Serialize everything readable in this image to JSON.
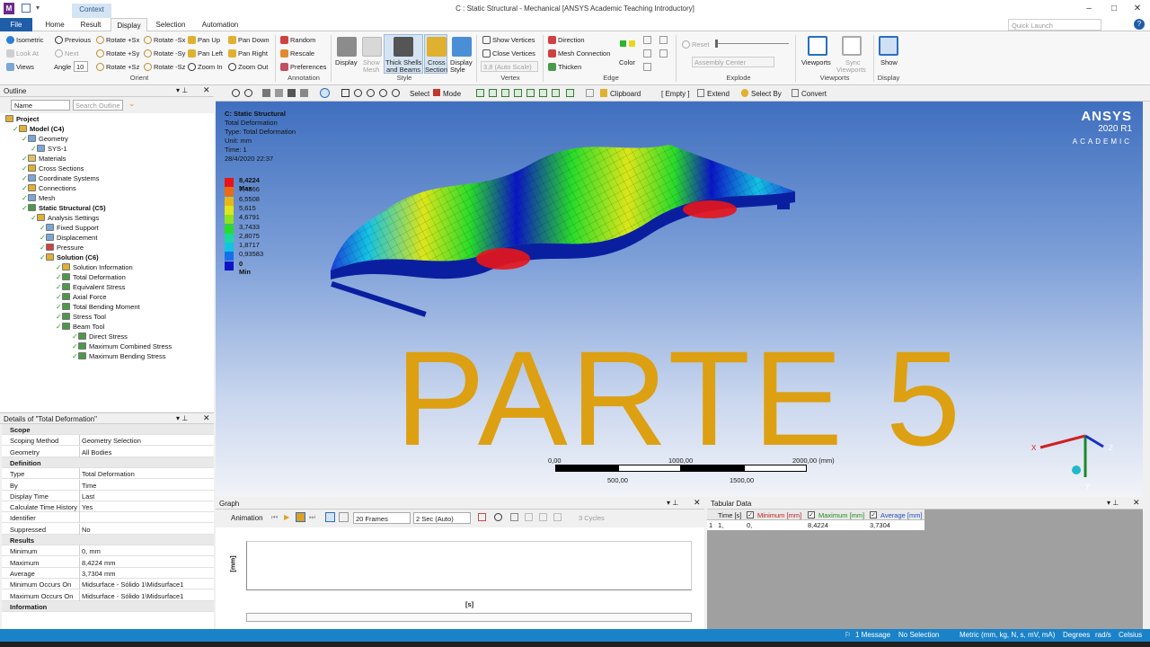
{
  "window": {
    "title": "C : Static Structural - Mechanical [ANSYS Academic Teaching Introductory]",
    "context_tab": "Context",
    "minimize": "–",
    "maximize": "□",
    "close": "✕"
  },
  "tabs": {
    "file": "File",
    "home": "Home",
    "result": "Result",
    "display": "Display",
    "selection": "Selection",
    "automation": "Automation"
  },
  "quick_launch": {
    "placeholder": "Quick Launch"
  },
  "ribbon": {
    "orient": {
      "isometric": "Isometric",
      "previous": "Previous",
      "look_at": "Look At",
      "next": "Next",
      "views": "Views",
      "angle_label": "Angle",
      "angle_value": "10",
      "rotate_px": "Rotate +Sx",
      "rotate_mx": "Rotate -Sx",
      "rotate_py": "Rotate +Sy",
      "rotate_my": "Rotate -Sy",
      "rotate_pz": "Rotate +Sz",
      "rotate_mz": "Rotate -Sz",
      "pan_up": "Pan Up",
      "pan_down": "Pan Down",
      "pan_left": "Pan Left",
      "pan_right": "Pan Right",
      "zoom_in": "Zoom In",
      "zoom_out": "Zoom Out",
      "group": "Orient"
    },
    "annotation": {
      "random": "Random",
      "rescale": "Rescale",
      "preferences": "Preferences",
      "group": "Annotation"
    },
    "style": {
      "display": "Display",
      "show_mesh_1": "Show",
      "show_mesh_2": "Mesh",
      "thick_1": "Thick Shells",
      "thick_2": "and Beams",
      "cross_1": "Cross",
      "cross_2": "Section",
      "display_style_1": "Display",
      "display_style_2": "Style",
      "group": "Style"
    },
    "vertex": {
      "show_vertices": "Show Vertices",
      "close_vertices": "Close Vertices",
      "auto_scale": "3,8 (Auto Scale)",
      "group": "Vertex"
    },
    "edge": {
      "direction": "Direction",
      "mesh_connection": "Mesh Connection",
      "thicken": "Thicken",
      "color": "Color",
      "group": "Edge"
    },
    "explode": {
      "reset": "Reset",
      "assembly_center": "Assembly Center",
      "group": "Explode"
    },
    "viewports": {
      "viewports": "Viewports",
      "sync_1": "Sync",
      "sync_2": "Viewports",
      "group": "Viewports"
    },
    "display_grp": {
      "show": "Show",
      "group": "Display"
    }
  },
  "outline": {
    "title": "Outline",
    "name_dropdown": "Name",
    "search_placeholder": "Search Outline",
    "tree": [
      {
        "label": "Project",
        "bold": true
      },
      {
        "label": "Model (C4)",
        "bold": true
      },
      {
        "label": "Geometry",
        "bold": false
      },
      {
        "label": "SYS-1",
        "bold": false
      },
      {
        "label": "Materials",
        "bold": false
      },
      {
        "label": "Cross Sections",
        "bold": false
      },
      {
        "label": "Coordinate Systems",
        "bold": false
      },
      {
        "label": "Connections",
        "bold": false
      },
      {
        "label": "Mesh",
        "bold": false
      },
      {
        "label": "Static Structural (C5)",
        "bold": true
      },
      {
        "label": "Analysis Settings",
        "bold": false
      },
      {
        "label": "Fixed Support",
        "bold": false
      },
      {
        "label": "Displacement",
        "bold": false
      },
      {
        "label": "Pressure",
        "bold": false
      },
      {
        "label": "Solution (C6)",
        "bold": true
      },
      {
        "label": "Solution Information",
        "bold": false
      },
      {
        "label": "Total Deformation",
        "bold": false
      },
      {
        "label": "Equivalent Stress",
        "bold": false
      },
      {
        "label": "Axial Force",
        "bold": false
      },
      {
        "label": "Total Bending Moment",
        "bold": false
      },
      {
        "label": "Stress Tool",
        "bold": false
      },
      {
        "label": "Beam Tool",
        "bold": false
      },
      {
        "label": "Direct Stress",
        "bold": false
      },
      {
        "label": "Maximum Combined Stress",
        "bold": false
      },
      {
        "label": "Maximum Bending Stress",
        "bold": false
      }
    ]
  },
  "details": {
    "title": "Details of \"Total Deformation\"",
    "rows": [
      {
        "k": "Scope",
        "v": "",
        "sec": true
      },
      {
        "k": "Scoping Method",
        "v": "Geometry Selection"
      },
      {
        "k": "Geometry",
        "v": "All Bodies"
      },
      {
        "k": "Definition",
        "v": "",
        "sec": true
      },
      {
        "k": "Type",
        "v": "Total Deformation"
      },
      {
        "k": "By",
        "v": "Time"
      },
      {
        "k": "Display Time",
        "v": "Last"
      },
      {
        "k": "Calculate Time History",
        "v": "Yes"
      },
      {
        "k": "Identifier",
        "v": ""
      },
      {
        "k": "Suppressed",
        "v": "No"
      },
      {
        "k": "Results",
        "v": "",
        "sec": true
      },
      {
        "k": "Minimum",
        "v": "0, mm"
      },
      {
        "k": "Maximum",
        "v": "8,4224 mm"
      },
      {
        "k": "Average",
        "v": "3,7304 mm"
      },
      {
        "k": "Minimum Occurs On",
        "v": "Midsurface - Sólido 1\\Midsurface1"
      },
      {
        "k": "Maximum Occurs On",
        "v": "Midsurface - Sólido 1\\Midsurface1"
      },
      {
        "k": "Information",
        "v": "",
        "sec": true
      }
    ]
  },
  "viewport_toolbar": {
    "select": "Select",
    "mode": "Mode",
    "clipboard": "Clipboard",
    "empty": "[ Empty ]",
    "extend": "Extend",
    "select_by": "Select By",
    "convert": "Convert"
  },
  "viewport": {
    "info": [
      "C: Static Structural",
      "Total Deformation",
      "Type: Total Deformation",
      "Unit: mm",
      "Time: 1",
      "28/4/2020 22:37"
    ],
    "legend": [
      {
        "label": "8,4224 Max",
        "color": "#e8141a"
      },
      {
        "label": "7,4866",
        "color": "#ea6b14"
      },
      {
        "label": "6,5508",
        "color": "#eab614"
      },
      {
        "label": "5,615",
        "color": "#dce61a"
      },
      {
        "label": "4,6791",
        "color": "#8fe31e"
      },
      {
        "label": "3,7433",
        "color": "#29dc2a"
      },
      {
        "label": "2,8075",
        "color": "#1cd7a0"
      },
      {
        "label": "1,8717",
        "color": "#14c2e4"
      },
      {
        "label": "0,93583",
        "color": "#1470e8"
      },
      {
        "label": "0 Min",
        "color": "#0b15c6"
      }
    ],
    "overlay_text": "PARTE 5",
    "logo_main": "ANSYS",
    "logo_version": "2020 R1",
    "logo_academic": "ACADEMIC",
    "scale": {
      "t0": "0,00",
      "t1": "1000,00",
      "t2": "2000,00 (mm)",
      "b1": "500,00",
      "b2": "1500,00"
    },
    "axes": {
      "x": "X",
      "y": "Y",
      "z": "Z"
    }
  },
  "graph": {
    "title": "Graph",
    "animation": "Animation",
    "frames": "20 Frames",
    "duration": "2 Sec (Auto)",
    "cycles": "3 Cycles",
    "ylabel": "[mm]",
    "xlabel": "[s]"
  },
  "tabular": {
    "title": "Tabular Data",
    "headers": [
      "Time [s]",
      "Minimum [mm]",
      "Maximum [mm]",
      "Average [mm]"
    ],
    "row_index": "1",
    "rows": [
      [
        "1,",
        "0,",
        "8,4224",
        "3,7304"
      ]
    ]
  },
  "status": {
    "message": "1 Message",
    "selection": "No Selection",
    "units": "Metric (mm, kg, N, s, mV, mA)",
    "angle": "Degrees",
    "rate": "rad/s",
    "temp": "Celsius"
  }
}
